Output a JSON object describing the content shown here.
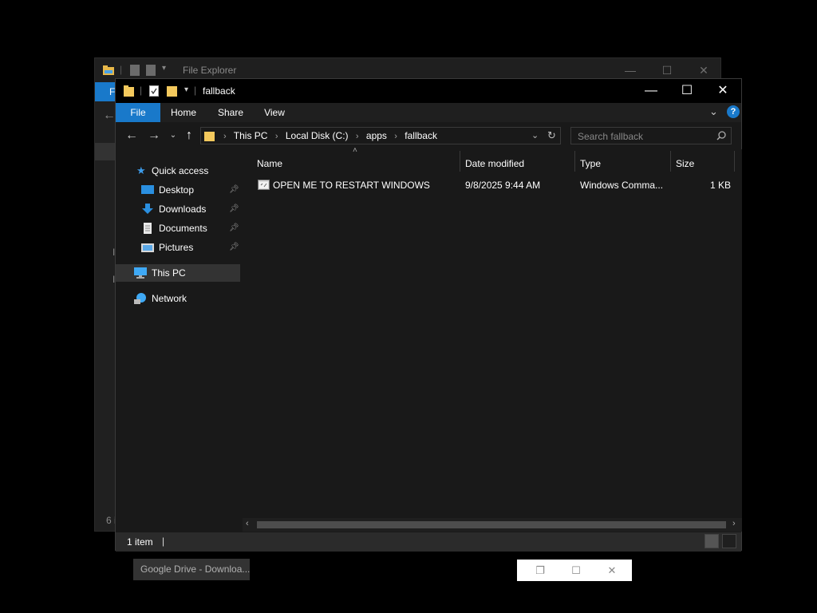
{
  "background_window": {
    "title": "File Explorer",
    "ribbon_tab": "F",
    "status": "6 i",
    "side_letters": [
      "I",
      "I"
    ]
  },
  "window": {
    "title": "fallback",
    "buttons": {
      "minimize": "—",
      "maximize": "☐",
      "close": "✕"
    },
    "ribbon": {
      "tabs": [
        "File",
        "Home",
        "Share",
        "View"
      ],
      "help": "?"
    },
    "address_bar": {
      "crumbs": [
        "This PC",
        "Local Disk (C:)",
        "apps",
        "fallback"
      ]
    },
    "search": {
      "placeholder": "Search fallback"
    },
    "nav_pane": {
      "quick_access": "Quick access",
      "items": [
        "Desktop",
        "Downloads",
        "Documents",
        "Pictures"
      ],
      "this_pc": "This PC",
      "network": "Network"
    },
    "columns": [
      "Name",
      "Date modified",
      "Type",
      "Size"
    ],
    "files": [
      {
        "name": "OPEN ME TO RESTART WINDOWS",
        "date": "9/8/2025 9:44 AM",
        "type": "Windows Comma...",
        "size": "1 KB"
      }
    ],
    "status": {
      "count": "1 item"
    }
  },
  "taskbar": {
    "gdrive": "Google Drive - Downloa..."
  },
  "colors": {
    "accent": "#1979ca",
    "folder": "#f4c95d",
    "background": "#000000"
  }
}
